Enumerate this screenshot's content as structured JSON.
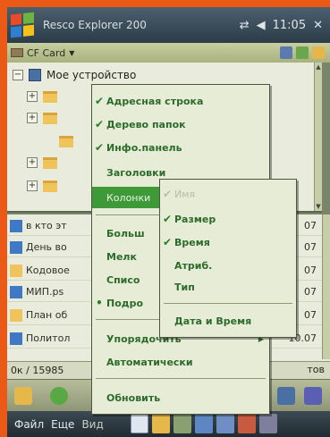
{
  "titlebar": {
    "title": "Resco Explorer 200",
    "time": "11:05",
    "close": "✕"
  },
  "location": {
    "label": "CF Card",
    "caret": "▼"
  },
  "tree": {
    "root": "Мое устройство",
    "plus": "+"
  },
  "list": {
    "rows": [
      {
        "label": "в кто эт",
        "date": "07"
      },
      {
        "label": "День во",
        "date": "07"
      },
      {
        "label": "Кодовое",
        "date": "07"
      },
      {
        "label": "МИП.рs",
        "date": "07"
      },
      {
        "label": "План об",
        "date": "07"
      },
      {
        "label": "Политол",
        "date": "10.07"
      }
    ]
  },
  "status": {
    "left": "0к / 15985",
    "right": "тов"
  },
  "menubar": {
    "file": "Файл",
    "more": "Еще",
    "view": "Вид"
  },
  "view_menu": {
    "items": [
      {
        "label": "Адресная строка",
        "checked": "✔"
      },
      {
        "label": "Дерево папок",
        "checked": "✔"
      },
      {
        "label": "Инфо.панель",
        "checked": "✔"
      },
      {
        "label": "Заголовки",
        "checked": ""
      },
      {
        "label": "Колонки",
        "checked": ""
      },
      {
        "label": "Больш",
        "checked": ""
      },
      {
        "label": "Мелк",
        "checked": ""
      },
      {
        "label": "Списо",
        "checked": ""
      },
      {
        "label": "Подро",
        "checked": "•"
      },
      {
        "label": "Упорядочить",
        "checked": ""
      },
      {
        "label": "Автоматически",
        "checked": ""
      },
      {
        "label": "Обновить",
        "checked": ""
      }
    ],
    "sub_arrow": "▶"
  },
  "columns_menu": {
    "items": [
      {
        "label": "Имя",
        "checked": "✔"
      },
      {
        "label": "Размер",
        "checked": "✔"
      },
      {
        "label": "Время",
        "checked": "✔"
      },
      {
        "label": "Атриб.",
        "checked": ""
      },
      {
        "label": "Тип",
        "checked": ""
      },
      {
        "label": "Дата и Время",
        "checked": ""
      }
    ]
  },
  "colors": {
    "accent": "#3d9a36",
    "titlebar": "#2c3c48",
    "orange": "#ea5a16"
  }
}
